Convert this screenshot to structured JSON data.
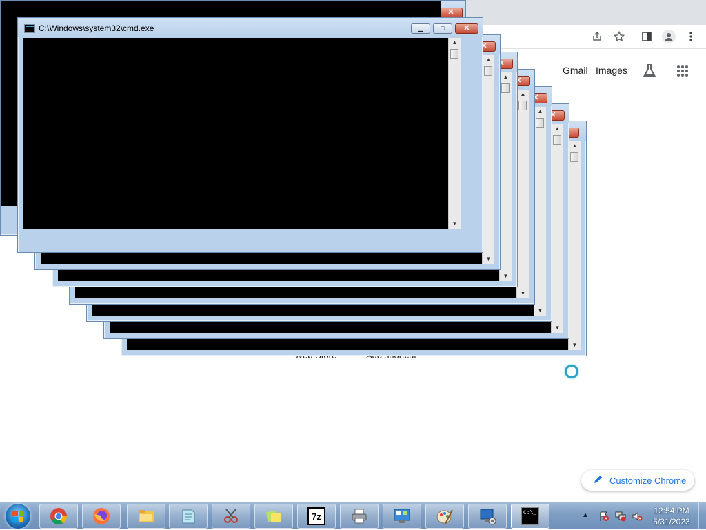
{
  "browser": {
    "links": {
      "gmail": "Gmail",
      "images": "Images"
    },
    "icons": [
      "share-icon",
      "bookmark-star-icon",
      "side-panel-icon",
      "profile-icon",
      "menu-dots-icon",
      "labs-flask-icon",
      "apps-grid-icon"
    ],
    "shortcuts": [
      "Web Store",
      "Add shortcut"
    ],
    "customize_label": "Customize Chrome"
  },
  "cmd_window": {
    "title": "C:\\Windows\\system32\\cmd.exe",
    "minimize_glyph": "▁",
    "maximize_glyph": "□",
    "close_glyph": "✕",
    "scroll_up_glyph": "▲",
    "scroll_down_glyph": "▼",
    "stack_count": 7
  },
  "taskbar": {
    "apps": [
      "chrome-icon",
      "firefox-icon",
      "file-explorer-icon",
      "notepad-icon",
      "snipping-tool-icon",
      "sticky-notes-icon",
      "7zip-icon",
      "printer-icon",
      "control-panel-icon",
      "paint-icon",
      "remote-desktop-icon",
      "cmd-icon"
    ],
    "sevenzip_label": "7z",
    "cmd_label": "C:\\_",
    "tray_arrow": "▲",
    "clock": {
      "time": "12:54 PM",
      "date": "5/31/2023"
    }
  },
  "colors": {
    "accent": "#1a73e8",
    "aero_frame": "#b9d1ea",
    "close_red": "#c74a36",
    "taskbar": "#7d9dc3"
  }
}
